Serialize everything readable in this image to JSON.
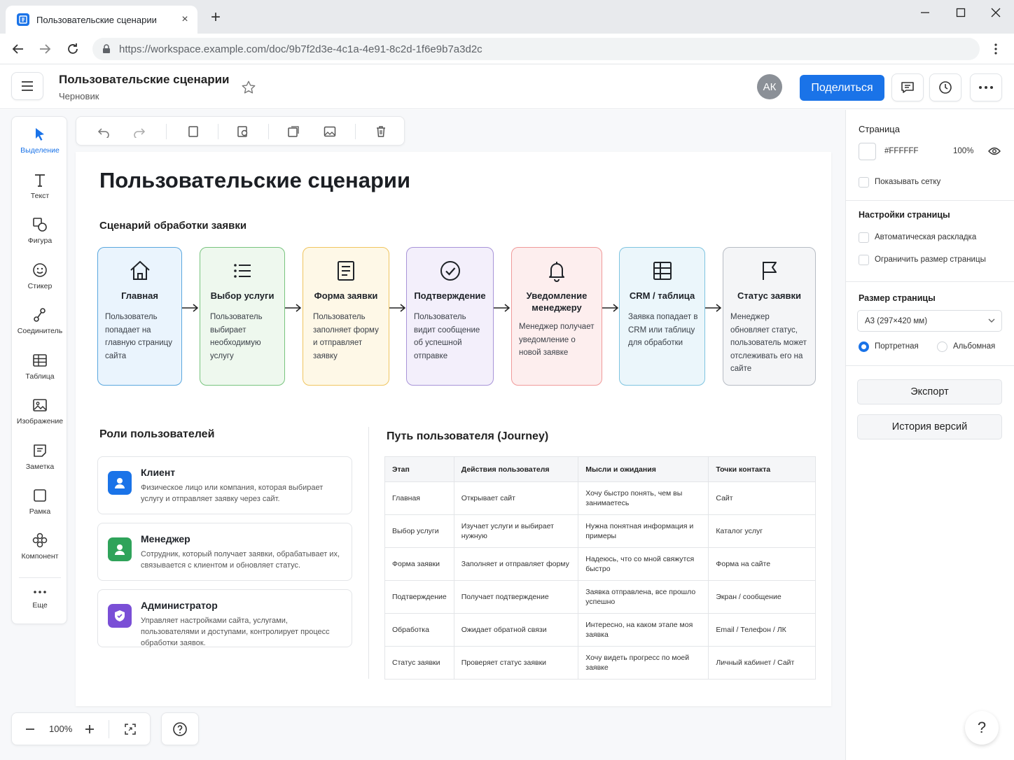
{
  "browser": {
    "tab_title": "Пользовательские сценарии",
    "url": "https://workspace.example.com/doc/9b7f2d3e-4c1a-4e91-8c2d-1f6e9b7a3d2c"
  },
  "header": {
    "doc_title": "Пользовательские сценарии",
    "doc_status": "Черновик",
    "avatar_initials": "АК",
    "share_label": "Поделиться"
  },
  "tools": [
    {
      "label": "Выделение",
      "icon": "cursor-icon"
    },
    {
      "label": "Текст",
      "icon": "text-icon"
    },
    {
      "label": "Фигура",
      "icon": "shape-icon"
    },
    {
      "label": "Стикер",
      "icon": "sticker-icon"
    },
    {
      "label": "Соединитель",
      "icon": "connector-icon"
    },
    {
      "label": "Таблица",
      "icon": "table-icon"
    },
    {
      "label": "Изображение",
      "icon": "image-icon"
    },
    {
      "label": "Заметка",
      "icon": "note-icon"
    },
    {
      "label": "Рамка",
      "icon": "frame-icon"
    },
    {
      "label": "Компонент",
      "icon": "component-icon"
    },
    {
      "label": "Еще",
      "icon": "more-icon"
    }
  ],
  "document": {
    "title": "Пользовательские сценарии",
    "flow_heading": "Сценарий обработки заявки",
    "flow": [
      {
        "title": "Главная",
        "desc": "Пользователь попадает на главную страницу сайта",
        "icon": "home-icon",
        "color": "#5aa7de",
        "bg": "#eaf4fd"
      },
      {
        "title": "Выбор услуги",
        "desc": "Пользователь выбирает необходимую услугу",
        "icon": "list-icon",
        "color": "#78c47e",
        "bg": "#eef8ee"
      },
      {
        "title": "Форма заявки",
        "desc": "Пользователь заполняет форму и отправляет заявку",
        "icon": "form-icon",
        "color": "#f0c560",
        "bg": "#fef8e7"
      },
      {
        "title": "Подтверждение",
        "desc": "Пользователь видит сообщение об успешной отправке",
        "icon": "check-circle-icon",
        "color": "#a894d8",
        "bg": "#f3effb"
      },
      {
        "title": "Уведомление менеджеру",
        "desc": "Менеджер получает уведомление о новой заявке",
        "icon": "bell-icon",
        "color": "#f09a9a",
        "bg": "#fdeeee"
      },
      {
        "title": "CRM / таблица",
        "desc": "Заявка попадает в CRM или таблицу для обработки",
        "icon": "table-icon",
        "color": "#7fc4e0",
        "bg": "#ebf6fb"
      },
      {
        "title": "Статус заявки",
        "desc": "Менеджер обновляет статус, пользователь может отслеживать его на сайте",
        "icon": "flag-icon",
        "color": "#b7bcc4",
        "bg": "#f4f5f7"
      }
    ],
    "roles_heading": "Роли пользователей",
    "roles": [
      {
        "title": "Клиент",
        "desc": "Физическое лицо или компания, которая выбирает услугу и отправляет заявку через сайт.",
        "color": "#1a73e8"
      },
      {
        "title": "Менеджер",
        "desc": "Сотрудник, который получает заявки, обрабатывает их, связывается с клиентом и обновляет статус.",
        "color": "#2fa35a"
      },
      {
        "title": "Администратор",
        "desc": "Управляет настройками сайта, услугами, пользователями и доступами, контролирует процесс обработки заявок.",
        "color": "#7a4fd6"
      }
    ],
    "journey_heading": "Путь пользователя (Journey)",
    "journey_headers": [
      "Этап",
      "Действия пользователя",
      "Мысли и ожидания",
      "Точки контакта"
    ],
    "journey_rows": [
      [
        "Главная",
        "Открывает сайт",
        "Хочу быстро понять, чем вы занимаетесь",
        "Сайт"
      ],
      [
        "Выбор услуги",
        "Изучает услуги и выбирает нужную",
        "Нужна понятная информация и примеры",
        "Каталог услуг"
      ],
      [
        "Форма заявки",
        "Заполняет и отправляет форму",
        "Надеюсь, что со мной свяжутся быстро",
        "Форма на сайте"
      ],
      [
        "Подтверждение",
        "Получает подтверждение",
        "Заявка отправлена, все прошло успешно",
        "Экран / сообщение"
      ],
      [
        "Обработка",
        "Ожидает обратной связи",
        "Интересно, на каком этапе моя заявка",
        "Email / Телефон / ЛК"
      ],
      [
        "Статус заявки",
        "Проверяет статус заявки",
        "Хочу видеть прогресс по моей заявке",
        "Личный кабинет / Сайт"
      ]
    ]
  },
  "panel": {
    "page_label": "Страница",
    "page_color": "#FFFFFF",
    "page_opacity": "100%",
    "show_grid": "Показывать сетку",
    "settings_label": "Настройки страницы",
    "auto_layout": "Автоматическая раскладка",
    "limit_size": "Ограничить размер страницы",
    "size_label": "Размер страницы",
    "size_value": "А3 (297×420 мм)",
    "portrait": "Портретная",
    "landscape": "Альбомная",
    "export": "Экспорт",
    "history": "История версий"
  },
  "zoom": {
    "value": "100%"
  },
  "help": "?"
}
